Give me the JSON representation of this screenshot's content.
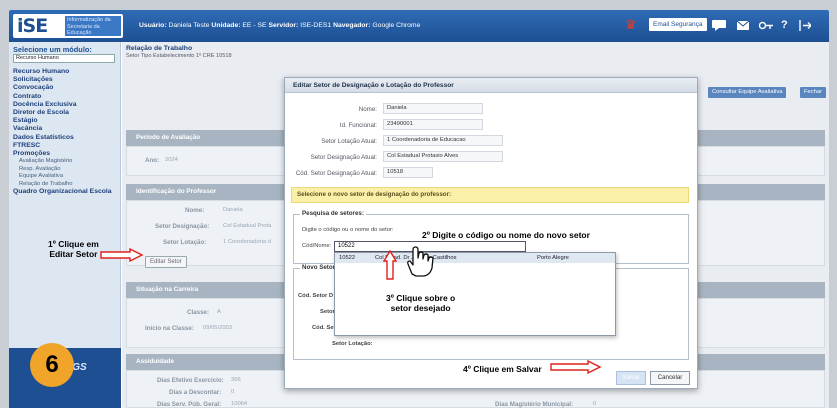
{
  "header": {
    "logo_mark": "iSE",
    "logo_text": "Informatização da Secretaria da Educação",
    "session_user_label": "Usuário:",
    "session_user": "Daniela Teste",
    "session_unit_label": "Unidade:",
    "session_unit": "EE - SE",
    "session_server_label": "Servidor:",
    "session_server": "ISE-DES1",
    "session_browser_label": "Navegador:",
    "session_browser": "Google Chrome",
    "email_button": "Email Segurança",
    "help_icon": "?"
  },
  "sidebar": {
    "module_title": "Selecione um módulo:",
    "module_value": "Recurso Humano",
    "items": [
      {
        "label": "Recurso Humano"
      },
      {
        "label": "Solicitações"
      },
      {
        "label": "Convocação"
      },
      {
        "label": "Contrato"
      },
      {
        "label": "Docência Exclusiva"
      },
      {
        "label": "Diretor de Escola"
      },
      {
        "label": "Estágio"
      },
      {
        "label": "Vacância"
      },
      {
        "label": "Dados Estatísticos"
      },
      {
        "label": "FTRESC"
      },
      {
        "label": "Promoções"
      }
    ],
    "subitems": [
      {
        "label": "Avaliação Magistério"
      },
      {
        "label": "Resp. Avaliação"
      },
      {
        "label": "Equipe Avaliativa"
      },
      {
        "label": "Relação de Trabalho"
      }
    ],
    "last_item": "Quadro Organizacional Escola",
    "footer_logo": "RGS"
  },
  "main": {
    "breadcrumb": "Relação de Trabalho",
    "breadcrumb_sub": "Setor Tipo Estabelecimento   1º CRE   10518",
    "btn_consultar": "Consultar Equipe Avaliativa",
    "btn_fechar": "Fechar",
    "sec_periodo": "Período de Avaliação",
    "ano_label": "Ano:",
    "ano_value": "2024",
    "sec_ident": "Identificação do Professor",
    "nome_label": "Nome:",
    "nome_value": "Daniela",
    "setor_desig_label": "Setor Designação:",
    "setor_desig_value": "Col Estadual Prota",
    "setor_lot_label": "Setor Lotação:",
    "setor_lot_value": "1 Coordenadoria d",
    "btn_editar_setor": "Editar Setor",
    "sec_carreira": "Situação na Carreira",
    "classe_label": "Classe:",
    "classe_value": "A",
    "inicio_label": "Início na Classe:",
    "inicio_value": "09/05/2003",
    "sec_assiduidade": "Assiduidade",
    "dias_efetivo_label": "Dias Efetivo Exercício:",
    "dias_efetivo_value": "366",
    "dias_descontar_label": "Dias a Descontar:",
    "dias_descontar_value": "0",
    "dias_serv_label": "Dias Serv. Púb. Geral:",
    "dias_serv_value": "10064",
    "dias_mag_label": "Dias Magistério Municipal:",
    "dias_mag_value": "0"
  },
  "modal": {
    "title": "Editar Setor de Designação e Lotação do Professor",
    "nome_label": "Nome:",
    "nome_value": "Daniela",
    "id_label": "Id. Funcional:",
    "id_value": "23490001",
    "lotacao_label": "Setor Lotação Atual:",
    "lotacao_value": "1 Coordenadoria de Educacao",
    "designacao_label": "Setor Designação Atual:",
    "designacao_value": "Col Estadual Protasio Alves",
    "cod_label": "Cód. Setor Designação Atual:",
    "cod_value": "10518",
    "hint": "Selecione o novo setor de designação do professor:",
    "pesquisa_legend": "Pesquisa de setores:",
    "pesquisa_help": "Digite o código ou o nome do setor:",
    "codnome_label": "Cód/Nome:",
    "search_value": "10522",
    "result_code": "10522",
    "result_name": "Col Estad. Dr Julio de Castilhos",
    "result_city": "Porto Alegre",
    "novo_legend": "Novo Setor:",
    "novo_cod_label": "Cód. Setor D",
    "novo_setor_label": "Setor D",
    "novo_setlot_label": "Cód. Set",
    "novo_lotacao_label": "Setor Lotação:",
    "btn_salvar": "Salvar",
    "btn_cancelar": "Cancelar"
  },
  "annotations": {
    "step1_line1": "1º Clique em",
    "step1_line2": "Editar Setor",
    "step2": "2º Digite o código ou nome do novo setor",
    "step3_line1": "3º Clique sobre o",
    "step3_line2": "setor desejado",
    "step4": "4º Clique em Salvar",
    "badge": "6",
    "arrow_color": "#e0201c",
    "badge_color": "#f0a52a"
  }
}
